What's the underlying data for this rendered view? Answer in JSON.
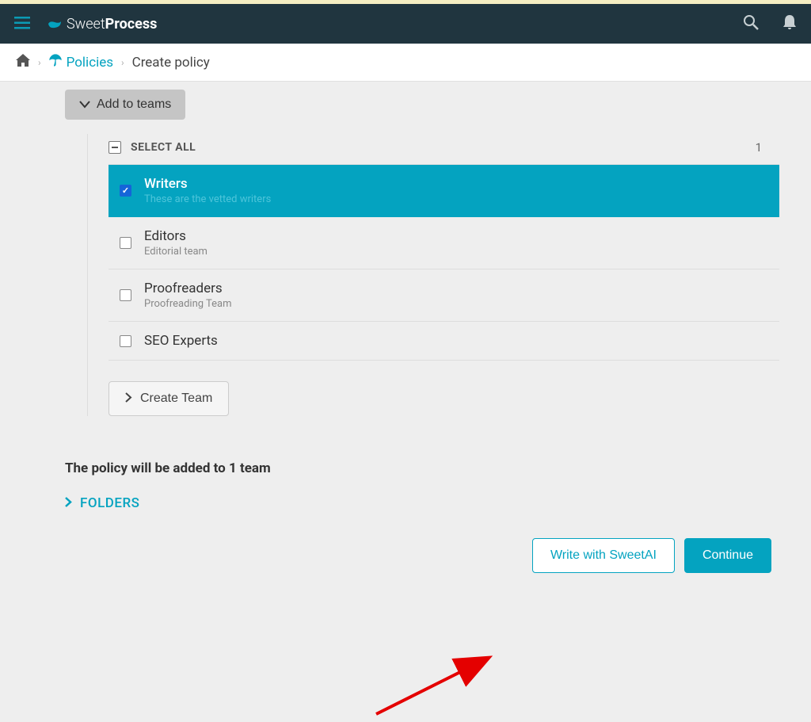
{
  "logo": {
    "part1": "Sweet",
    "part2": "Process"
  },
  "breadcrumb": {
    "policies": "Policies",
    "current": "Create policy"
  },
  "addTeamsLabel": "Add to teams",
  "selectAllLabel": "SELECT ALL",
  "selectedCount": "1",
  "teams": [
    {
      "name": "Writers",
      "desc": "These are the vetted writers",
      "selected": true
    },
    {
      "name": "Editors",
      "desc": "Editorial team",
      "selected": false
    },
    {
      "name": "Proofreaders",
      "desc": "Proofreading Team",
      "selected": false
    },
    {
      "name": "SEO Experts",
      "desc": "",
      "selected": false
    }
  ],
  "createTeamLabel": "Create Team",
  "summaryText": "The policy will be added to 1 team",
  "foldersLabel": "FOLDERS",
  "writeAiLabel": "Write with SweetAI",
  "continueLabel": "Continue"
}
